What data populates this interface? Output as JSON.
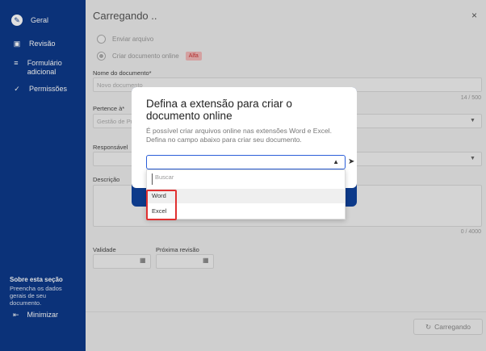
{
  "sidebar": {
    "items": [
      {
        "label": "Geral",
        "icon": "pencil-icon"
      },
      {
        "label": "Revisão",
        "icon": "review-icon"
      },
      {
        "label": "Formulário adicional",
        "icon": "form-icon"
      },
      {
        "label": "Permissões",
        "icon": "check-icon"
      }
    ],
    "foot_title": "Sobre esta seção",
    "foot_text": "Preencha os dados gerais de seu documento.",
    "minimize": "Minimizar"
  },
  "main": {
    "title": "Carregando ..",
    "close": "×",
    "radio_send": "Enviar arquivo",
    "radio_create": "Criar documento online",
    "badge": "Alfa",
    "doc_name_label": "Nome do documento*",
    "doc_name_placeholder": "Novo documento",
    "doc_name_counter": "14 / 500",
    "belongs_label": "Pertence à*",
    "belongs_value": "Gestão de Pr",
    "responsible_label": "Responsável",
    "description_label": "Descrição",
    "description_counter": "0 / 4000",
    "validity_label": "Validade",
    "next_review_label": "Próxima revisão",
    "loading_button": "Carregando"
  },
  "modal": {
    "title": "Defina a extensão para criar o documento online",
    "text": "É possível criar arquivos online nas extensões Word e Excel. Defina no campo abaixo para criar seu documento.",
    "search_placeholder": "Buscar",
    "options": [
      "Word",
      "Excel"
    ]
  },
  "colors": {
    "sidebar": "#0d3a8a",
    "select_border": "#2b5fd9",
    "highlight": "#e03030"
  }
}
